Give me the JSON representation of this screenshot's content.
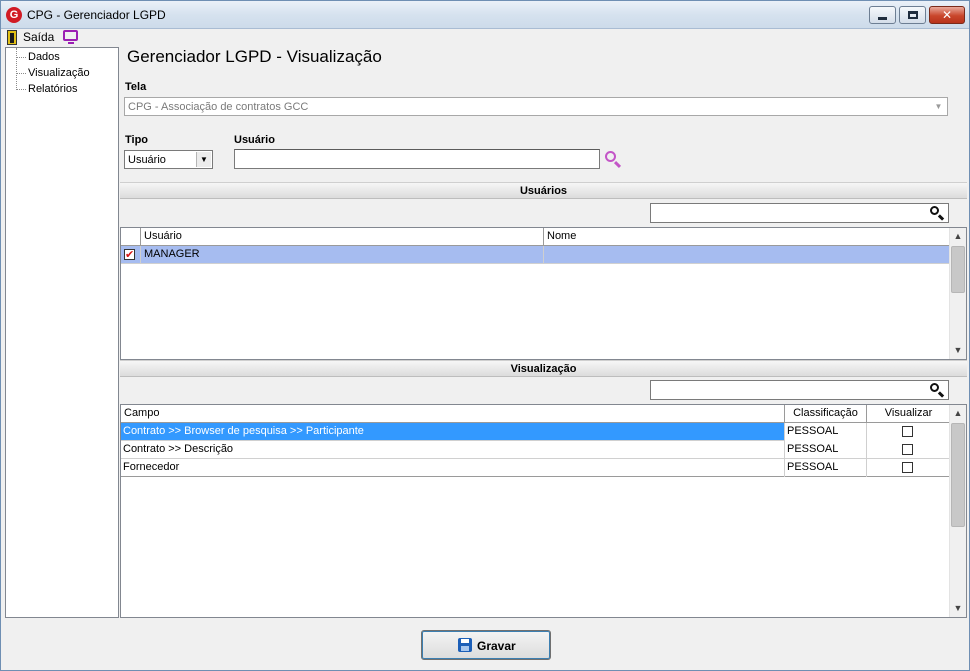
{
  "window": {
    "title": "CPG - Gerenciador LGPD",
    "logo_letter": "G"
  },
  "menubar": {
    "exit_label": "Saída"
  },
  "sidebar": {
    "items": [
      {
        "label": "Dados"
      },
      {
        "label": "Visualização"
      },
      {
        "label": "Relatórios"
      }
    ]
  },
  "page": {
    "title": "Gerenciador LGPD - Visualização",
    "tela_label": "Tela",
    "tela_value": "CPG - Associação de contratos GCC",
    "tipo_label": "Tipo",
    "tipo_value": "Usuário",
    "usuario_label": "Usuário",
    "usuario_value": ""
  },
  "users_section": {
    "header": "Usuários",
    "filter_value": "",
    "columns": [
      "Usuário",
      "Nome"
    ],
    "rows": [
      {
        "checked": true,
        "usuario": "MANAGER",
        "nome": ""
      }
    ]
  },
  "visualizacao_section": {
    "header": "Visualização",
    "filter_value": "",
    "columns": [
      "Campo",
      "Classificação",
      "Visualizar"
    ],
    "rows": [
      {
        "campo": "Contrato >> Browser de pesquisa >> Participante",
        "classificacao": "PESSOAL",
        "visualizar": false
      },
      {
        "campo": "Contrato >> Descrição",
        "classificacao": "PESSOAL",
        "visualizar": false
      },
      {
        "campo": "Fornecedor",
        "classificacao": "PESSOAL",
        "visualizar": false
      }
    ]
  },
  "footer": {
    "save_label": "Gravar"
  },
  "colors": {
    "selected_row_blue": "#3399ff",
    "selected_row_lavender": "#a6bcf0",
    "search_icon": "#c355c7",
    "save_icon": "#1c5fb8"
  }
}
